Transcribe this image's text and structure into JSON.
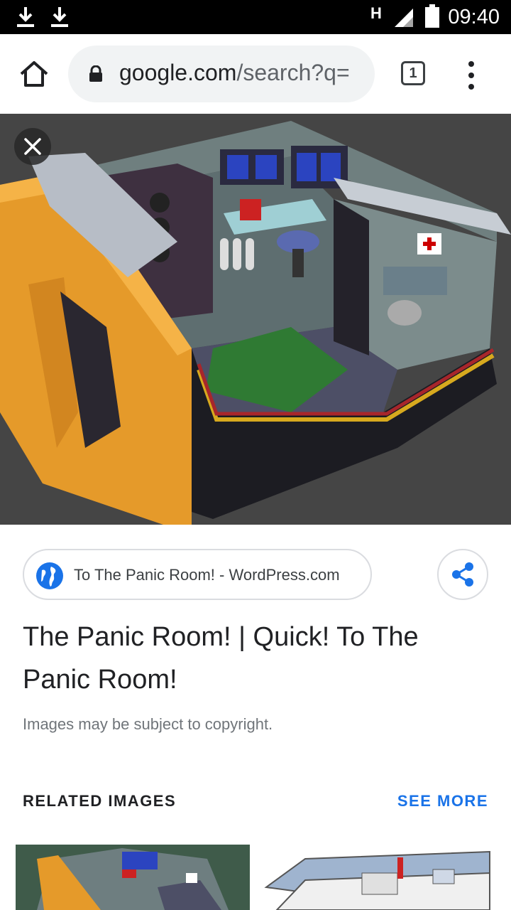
{
  "status_bar": {
    "network": "H",
    "time": "09:40"
  },
  "browser": {
    "url_domain": "google.com",
    "url_path": "/search?q=",
    "tab_count": "1"
  },
  "viewer": {
    "source": "To The Panic Room! - WordPress.com",
    "title": "The Panic Room! | Quick! To The Panic Room!",
    "copyright_note": "Images may be subject to copyright.",
    "related_heading": "RELATED IMAGES",
    "see_more": "SEE MORE"
  },
  "colors": {
    "accent": "#1a73e8",
    "status_bar": "#000000",
    "omnibox": "#f1f3f4"
  }
}
